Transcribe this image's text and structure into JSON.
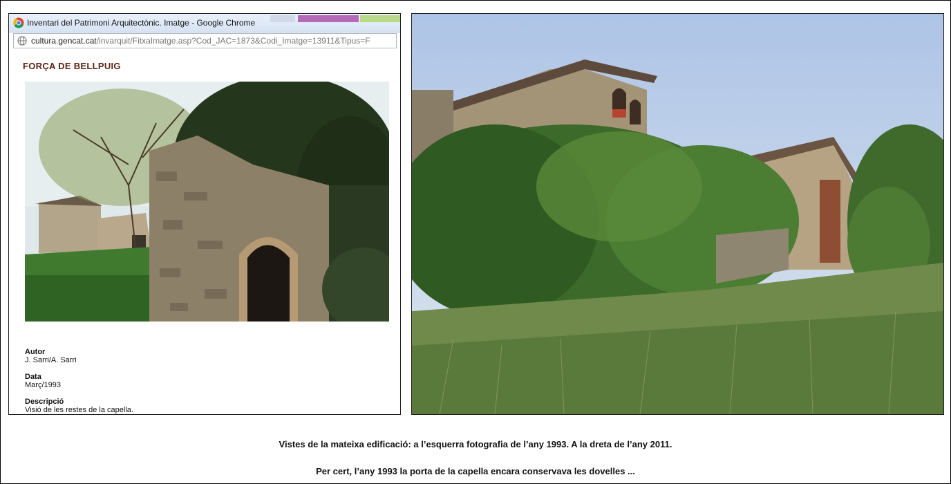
{
  "window": {
    "title": "Inventari del Patrimoni Arquitectònic. Imatge - Google Chrome"
  },
  "address_bar": {
    "host": "cultura.gencat.cat",
    "path": "/invarquit/FitxaImatge.asp?Cod_JAC=1873&Codi_Imatge=13911&Tipus=F"
  },
  "page": {
    "title": "FORÇA DE BELLPUIG",
    "fields": [
      {
        "label": "Autor",
        "value": "J. Sarri/A. Sarri"
      },
      {
        "label": "Data",
        "value": "Març/1993"
      },
      {
        "label": "Descripció",
        "value": "Visió de les restes de la capella."
      }
    ]
  },
  "captions": {
    "line1": "Vistes de la mateixa edificació: a l’esquerra fotografia de l’any 1993. A la dreta de l’any 2011.",
    "line2": "Per cert, l’any 1993 la porta de la capella encara conservava les dovelles ..."
  },
  "icons": {
    "browser": "chrome-icon",
    "address": "globe-icon"
  },
  "colors": {
    "page_title": "#5a2312",
    "titlebar": "#dce6f4"
  }
}
